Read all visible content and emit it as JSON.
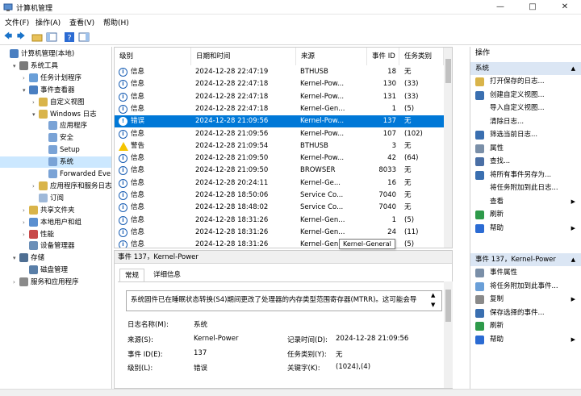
{
  "window": {
    "title": "计算机管理"
  },
  "menu": [
    "文件(F)",
    "操作(A)",
    "查看(V)",
    "帮助(H)"
  ],
  "tree": [
    {
      "label": "计算机管理(本地)",
      "level": 0,
      "exp": ""
    },
    {
      "label": "系统工具",
      "level": 1,
      "exp": "▾"
    },
    {
      "label": "任务计划程序",
      "level": 2,
      "exp": "›"
    },
    {
      "label": "事件查看器",
      "level": 2,
      "exp": "▾"
    },
    {
      "label": "自定义视图",
      "level": 3,
      "exp": "›"
    },
    {
      "label": "Windows 日志",
      "level": 3,
      "exp": "▾"
    },
    {
      "label": "应用程序",
      "level": 4,
      "exp": ""
    },
    {
      "label": "安全",
      "level": 4,
      "exp": ""
    },
    {
      "label": "Setup",
      "level": 4,
      "exp": ""
    },
    {
      "label": "系统",
      "level": 4,
      "exp": "",
      "selected": true
    },
    {
      "label": "Forwarded Eve",
      "level": 4,
      "exp": ""
    },
    {
      "label": "应用程序和服务日志",
      "level": 3,
      "exp": "›"
    },
    {
      "label": "订阅",
      "level": 3,
      "exp": ""
    },
    {
      "label": "共享文件夹",
      "level": 2,
      "exp": "›"
    },
    {
      "label": "本地用户和组",
      "level": 2,
      "exp": "›"
    },
    {
      "label": "性能",
      "level": 2,
      "exp": "›"
    },
    {
      "label": "设备管理器",
      "level": 2,
      "exp": ""
    },
    {
      "label": "存储",
      "level": 1,
      "exp": "▾"
    },
    {
      "label": "磁盘管理",
      "level": 2,
      "exp": ""
    },
    {
      "label": "服务和应用程序",
      "level": 1,
      "exp": "›"
    }
  ],
  "list": {
    "headers": [
      "级别",
      "日期和时间",
      "来源",
      "事件 ID",
      "任务类别"
    ],
    "rows": [
      {
        "level": "信息",
        "type": "info",
        "date": "2024-12-28 22:47:19",
        "source": "BTHUSB",
        "id": "18",
        "cat": "无"
      },
      {
        "level": "信息",
        "type": "info",
        "date": "2024-12-28 22:47:18",
        "source": "Kernel-Pow...",
        "id": "130",
        "cat": "(33)"
      },
      {
        "level": "信息",
        "type": "info",
        "date": "2024-12-28 22:47:18",
        "source": "Kernel-Pow...",
        "id": "131",
        "cat": "(33)"
      },
      {
        "level": "信息",
        "type": "info",
        "date": "2024-12-28 22:47:18",
        "source": "Kernel-Gen...",
        "id": "1",
        "cat": "(5)"
      },
      {
        "level": "错误",
        "type": "error",
        "date": "2024-12-28 21:09:56",
        "source": "Kernel-Pow...",
        "id": "137",
        "cat": "无",
        "selected": true
      },
      {
        "level": "信息",
        "type": "info",
        "date": "2024-12-28 21:09:56",
        "source": "Kernel-Pow...",
        "id": "107",
        "cat": "(102)"
      },
      {
        "level": "警告",
        "type": "warning",
        "date": "2024-12-28 21:09:54",
        "source": "BTHUSB",
        "id": "3",
        "cat": "无"
      },
      {
        "level": "信息",
        "type": "info",
        "date": "2024-12-28 21:09:50",
        "source": "Kernel-Pow...",
        "id": "42",
        "cat": "(64)"
      },
      {
        "level": "信息",
        "type": "info",
        "date": "2024-12-28 21:09:50",
        "source": "BROWSER",
        "id": "8033",
        "cat": "无"
      },
      {
        "level": "信息",
        "type": "info",
        "date": "2024-12-28 20:24:11",
        "source": "Kernel-Ge...",
        "id": "16",
        "cat": "无"
      },
      {
        "level": "信息",
        "type": "info",
        "date": "2024-12-28 18:50:06",
        "source": "Service Co...",
        "id": "7040",
        "cat": "无"
      },
      {
        "level": "信息",
        "type": "info",
        "date": "2024-12-28 18:48:02",
        "source": "Service Co...",
        "id": "7040",
        "cat": "无"
      },
      {
        "level": "信息",
        "type": "info",
        "date": "2024-12-28 18:31:26",
        "source": "Kernel-Gen...",
        "id": "1",
        "cat": "(5)"
      },
      {
        "level": "信息",
        "type": "info",
        "date": "2024-12-28 18:31:26",
        "source": "Kernel-Gen...",
        "id": "24",
        "cat": "(11)"
      },
      {
        "level": "信息",
        "type": "info",
        "date": "2024-12-28 18:31:26",
        "source": "Kernel-Gen...",
        "id": "",
        "cat": "(5)"
      }
    ]
  },
  "tooltip": "Kernel-General",
  "detail": {
    "title": "事件 137，Kernel-Power",
    "tabs": [
      "常规",
      "详细信息"
    ],
    "message": "系统固件已在睡眠状态转换(S4)期间更改了处理器的内存类型范围寄存器(MTRR)。这可能会导",
    "fields": {
      "logname_label": "日志名称(M):",
      "logname": "系统",
      "source_label": "来源(S):",
      "source": "Kernel-Power",
      "logged_label": "记录时间(D):",
      "logged": "2024-12-28 21:09:56",
      "eventid_label": "事件 ID(E):",
      "eventid": "137",
      "task_label": "任务类别(Y):",
      "task": "无",
      "level_label": "级别(L):",
      "level": "错误",
      "keywords_label": "关键字(K):",
      "keywords": "(1024),(4)"
    }
  },
  "actions": {
    "header": "操作",
    "section1": "系统",
    "items1": [
      {
        "label": "打开保存的日志...",
        "icon": "folder-icon"
      },
      {
        "label": "创建自定义视图...",
        "icon": "filter-icon"
      },
      {
        "label": "导入自定义视图...",
        "icon": ""
      },
      {
        "label": "清除日志...",
        "icon": ""
      },
      {
        "label": "筛选当前日志...",
        "icon": "filter-icon"
      },
      {
        "label": "属性",
        "icon": "properties-icon"
      },
      {
        "label": "查找...",
        "icon": "find-icon"
      },
      {
        "label": "将所有事件另存为...",
        "icon": "save-icon"
      },
      {
        "label": "将任务附加到此日志...",
        "icon": ""
      },
      {
        "label": "查看",
        "icon": "",
        "sub": true
      },
      {
        "label": "刷新",
        "icon": "refresh-icon"
      },
      {
        "label": "帮助",
        "icon": "help-icon",
        "sub": true
      }
    ],
    "section2": "事件 137，Kernel-Power",
    "items2": [
      {
        "label": "事件属性",
        "icon": "properties-icon"
      },
      {
        "label": "将任务附加到此事件...",
        "icon": "task-icon"
      },
      {
        "label": "复制",
        "icon": "copy-icon",
        "sub": true
      },
      {
        "label": "保存选择的事件...",
        "icon": "save-icon"
      },
      {
        "label": "刷新",
        "icon": "refresh-icon"
      },
      {
        "label": "帮助",
        "icon": "help-icon",
        "sub": true
      }
    ]
  }
}
